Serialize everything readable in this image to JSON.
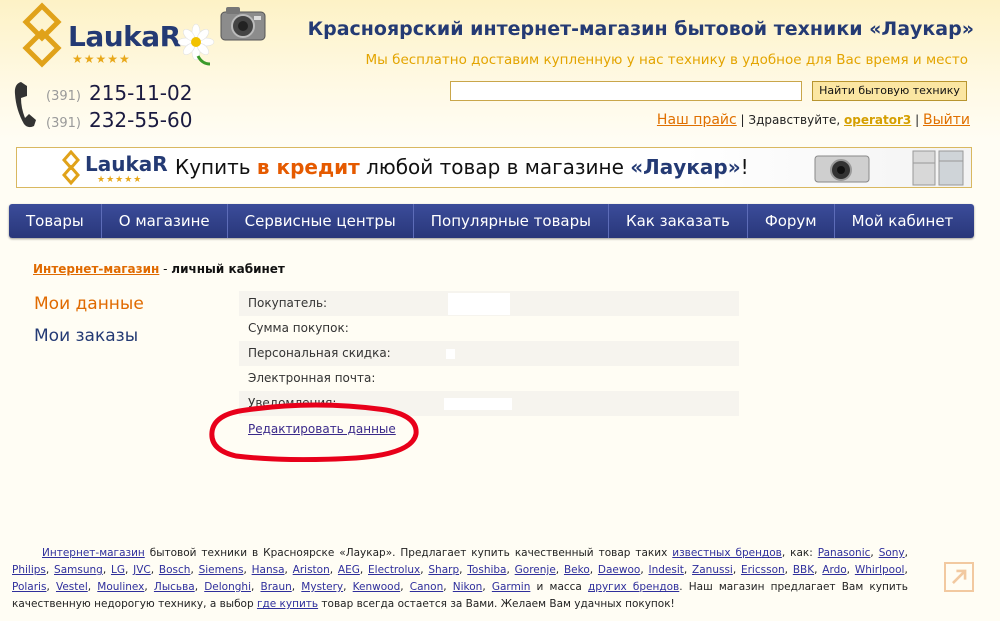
{
  "header": {
    "logo_text": "LaukaR",
    "logo_stars": "★★★★★",
    "site_title": "Красноярский интернет-магазин бытовой техники «Лаукар»",
    "site_subtitle": "Мы бесплатно доставим купленную у нас технику в удобное для Вас время и место"
  },
  "phones": [
    {
      "code": "(391)",
      "number": "215-11-02"
    },
    {
      "code": "(391)",
      "number": "232-55-60"
    }
  ],
  "search": {
    "value": "",
    "placeholder": "",
    "button_label": "Найти бытовую технику"
  },
  "user_bar": {
    "price_link": "Наш прайс",
    "separator": "|",
    "greeting": "Здравствуйте,",
    "username": "operator3",
    "logout": "Выйти"
  },
  "banner": {
    "logo_text": "LaukaR",
    "logo_stars": "★★★★★",
    "text_before": "Купить ",
    "text_accent": "в кредит",
    "text_middle": " любой товар в магазине ",
    "text_brand": "«Лаукар»",
    "text_end": "!"
  },
  "nav": {
    "items": [
      {
        "label": "Товары"
      },
      {
        "label": "О магазине"
      },
      {
        "label": "Сервисные центры"
      },
      {
        "label": "Популярные товары"
      },
      {
        "label": "Как заказать"
      },
      {
        "label": "Форум"
      },
      {
        "label": "Мой кабинет"
      }
    ]
  },
  "breadcrumb": {
    "home": "Интернет-магазин",
    "separator": " - ",
    "current": "личный кабинет"
  },
  "side_menu": {
    "my_data": "Мои данные",
    "my_orders": "Мои заказы"
  },
  "profile": {
    "fields": [
      {
        "label": "Покупатель:"
      },
      {
        "label": "Сумма покупок:"
      },
      {
        "label": "Персональная скидка:"
      },
      {
        "label": "Электронная почта:"
      },
      {
        "label": "Уведомления:"
      }
    ],
    "edit_link": "Редактировать данные"
  },
  "footer": {
    "online_store_link": "Интернет-магазин",
    "text_1": " бытовой техники в Красноярске «Лаукар». Предлагает купить качественный товар таких ",
    "known_brands_link": "известных брендов",
    "text_2": ", как: ",
    "brands": [
      "Panasonic",
      "Sony",
      "Philips",
      "Samsung",
      "LG",
      "JVC",
      "Bosch",
      "Siemens",
      "Hansa",
      "Ariston",
      "AEG",
      "Electrolux",
      "Sharp",
      "Toshiba",
      "Gorenje",
      "Beko",
      "Daewoo",
      "Indesit",
      "Zanussi",
      "Ericsson",
      "BBK",
      "Ardo",
      "Whirlpool",
      "Polaris",
      "Vestel",
      "Moulinex",
      "Лысьва",
      "Delonghi",
      "Braun",
      "Mystery",
      "Kenwood",
      "Canon",
      "Nikon",
      "Garmin"
    ],
    "text_3": " и масса ",
    "other_brands_link": "других брендов",
    "text_4": ". Наш магазин предлагает Вам купить качественную недорогую технику, а выбор ",
    "where_to_buy_link": "где купить",
    "text_5": " товар всегда остается за Вами. Желаем Вам удачных покупок!"
  },
  "colors": {
    "nav_bg": "#2f3d86",
    "brand_blue": "#243a74",
    "accent_orange": "#e06a00",
    "annotation_red": "#e8001a"
  }
}
